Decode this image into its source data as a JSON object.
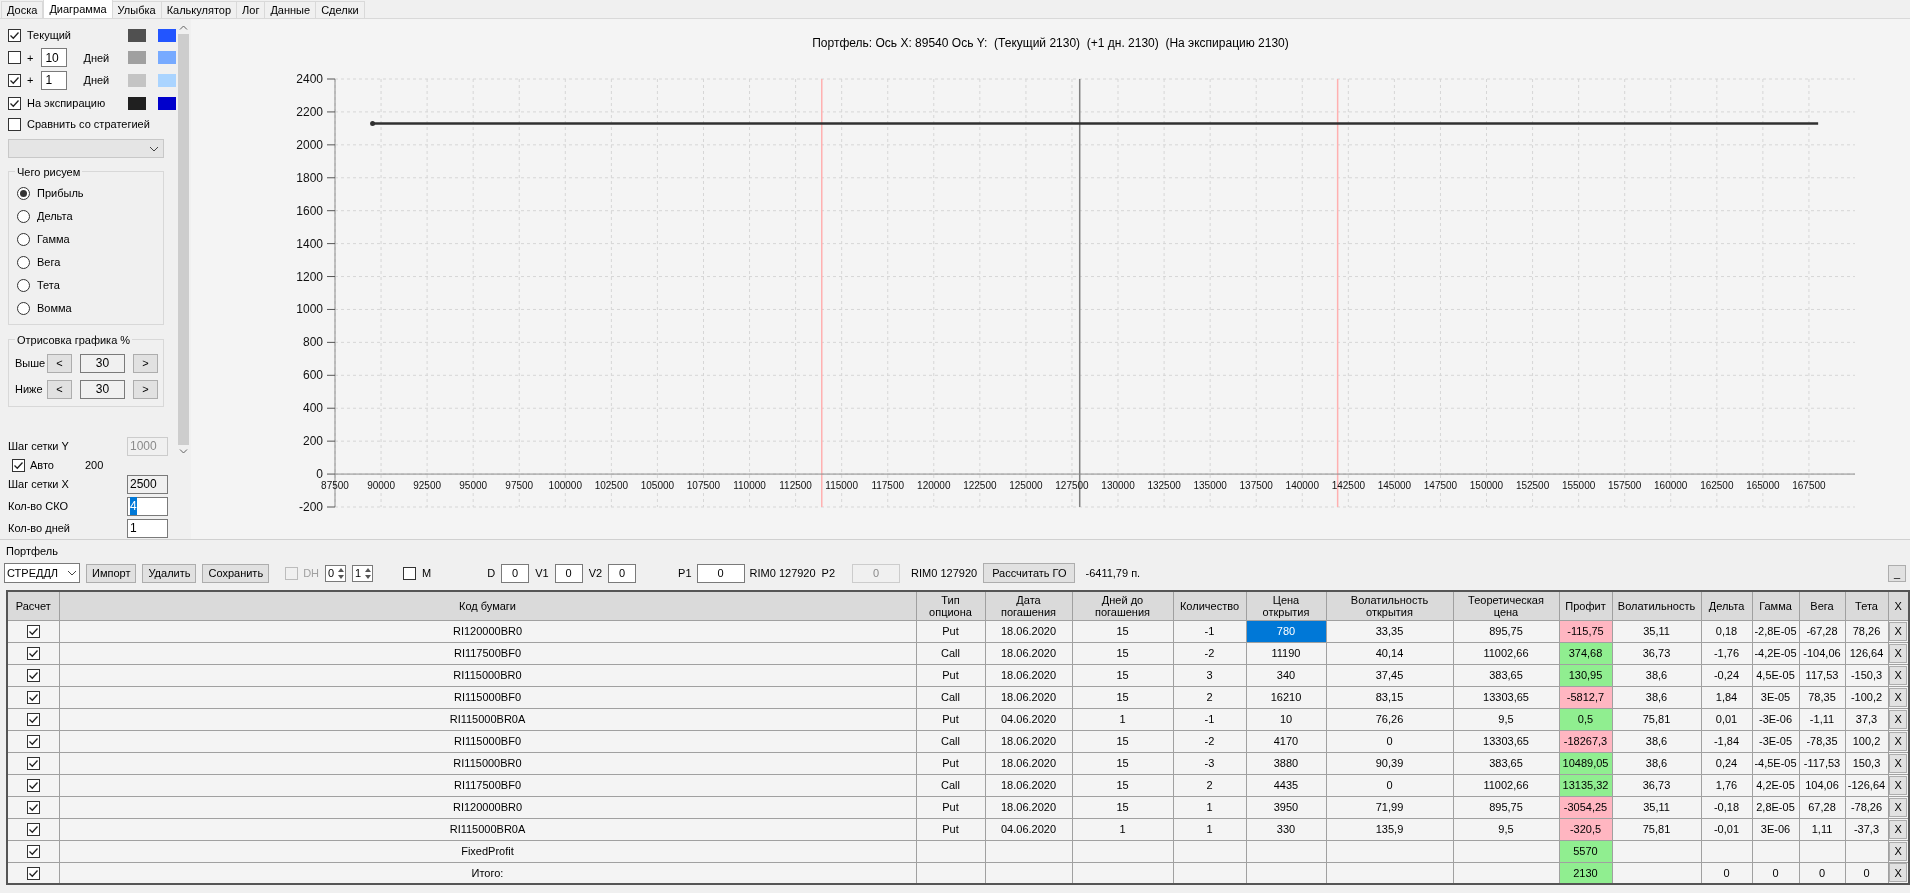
{
  "tabs": [
    {
      "label": "Доска",
      "selected": false
    },
    {
      "label": "Диаграмма",
      "selected": true
    },
    {
      "label": "Улыбка",
      "selected": false
    },
    {
      "label": "Калькулятор",
      "selected": false
    },
    {
      "label": "Лог",
      "selected": false
    },
    {
      "label": "Данные",
      "selected": false
    },
    {
      "label": "Сделки",
      "selected": false
    }
  ],
  "sidebar": {
    "curves": [
      {
        "kind": "curve",
        "label": "Текущий",
        "checked": true,
        "swatches": [
          {
            "color": "#505050"
          },
          {
            "color": "#2255ff"
          }
        ]
      },
      {
        "kind": "days",
        "prefix": "+",
        "days": "10",
        "unit": "Дней",
        "checked": false,
        "swatches": [
          {
            "color": "#a0a0a0"
          },
          {
            "color": "#77aaff"
          }
        ]
      },
      {
        "kind": "days",
        "prefix": "+",
        "days": "1",
        "unit": "Дней",
        "checked": true,
        "swatches": [
          {
            "color": "#c4c4c4"
          },
          {
            "color": "#aad4ff"
          }
        ]
      },
      {
        "kind": "curve",
        "label": "На экспирацию",
        "checked": true,
        "swatches": [
          {
            "color": "#202020"
          },
          {
            "color": "#0000cc"
          }
        ]
      }
    ],
    "compare": {
      "label": "Сравнить со стратегией",
      "checked": false
    },
    "plot_group": {
      "title": "Чего рисуем",
      "options": [
        {
          "label": "Прибыль",
          "selected": true
        },
        {
          "label": "Дельта",
          "selected": false
        },
        {
          "label": "Гамма",
          "selected": false
        },
        {
          "label": "Вега",
          "selected": false
        },
        {
          "label": "Тета",
          "selected": false
        },
        {
          "label": "Вомма",
          "selected": false
        }
      ]
    },
    "range_group": {
      "title": "Отрисовка графика %",
      "rows": [
        {
          "label": "Выше",
          "dec": "<",
          "value": "30",
          "inc": ">"
        },
        {
          "label": "Ниже",
          "dec": "<",
          "value": "30",
          "inc": ">"
        }
      ]
    },
    "settings": [
      {
        "kind": "field",
        "label": "Шаг сетки Y",
        "value": "1000",
        "disabled": true,
        "readonly": false,
        "text_selected": false
      },
      {
        "kind": "check",
        "label": "Авто",
        "checked": true,
        "value": "200"
      },
      {
        "kind": "field",
        "label": "Шаг сетки X",
        "value": "2500",
        "disabled": false,
        "readonly": true,
        "text_selected": false
      },
      {
        "kind": "field",
        "label": "Кол-во СКО",
        "value": "4",
        "disabled": false,
        "readonly": false,
        "text_selected": true
      },
      {
        "kind": "field",
        "label": "Кол-во дней",
        "value": "1",
        "disabled": false,
        "readonly": false,
        "text_selected": false
      }
    ]
  },
  "chart": {
    "chart_data": {
      "type": "line",
      "title": "Портфель: Ось X: 89540 Ось Y:  (Текущий 2130)  (+1 дн. 2130)  (На экспирацию 2130)",
      "x": [
        89540,
        168000
      ],
      "series": [
        {
          "color": "#303030",
          "values": [
            2130,
            2130
          ]
        }
      ],
      "xlim": [
        87500,
        170000
      ],
      "ylim": [
        -200,
        2400
      ],
      "xticks": [
        87500,
        90000,
        92500,
        95000,
        97500,
        100000,
        102500,
        105000,
        107500,
        110000,
        112500,
        115000,
        117500,
        120000,
        122500,
        125000,
        127500,
        130000,
        132500,
        135000,
        137500,
        140000,
        142500,
        145000,
        147500,
        150000,
        152500,
        155000,
        157500,
        160000,
        162500,
        165000,
        167500
      ],
      "yticks": [
        -200,
        0,
        200,
        400,
        600,
        800,
        1000,
        1200,
        1400,
        1600,
        1800,
        2000,
        2200,
        2400
      ],
      "grid": true,
      "ref_lines": [
        {
          "axis": "x",
          "value": 113920,
          "color": "#ffb0b0"
        },
        {
          "axis": "x",
          "value": 127920,
          "color": "#808080"
        },
        {
          "axis": "x",
          "value": 141920,
          "color": "#ffb0b0"
        }
      ]
    }
  },
  "portfolio": {
    "title": "Портфель",
    "strategy": "СТРЕДДЛ",
    "buttons": [
      "Импорт",
      "Удалить",
      "Сохранить"
    ],
    "dh": {
      "label": "DH",
      "checked": false,
      "disabled": true
    },
    "spinners": [
      "0",
      "1"
    ],
    "m": {
      "label": "M",
      "checked": false
    },
    "params": [
      {
        "label": "D",
        "value": "0"
      },
      {
        "label": "V1",
        "value": "0"
      },
      {
        "label": "V2",
        "value": "0"
      }
    ],
    "prices": [
      {
        "label": "P1",
        "value": "0",
        "note": "RIM0 127920",
        "disabled": false
      },
      {
        "label": "P2",
        "value": "0",
        "note": "RIM0 127920",
        "disabled": true
      }
    ],
    "calc_button": "Рассчитать ГО",
    "margin": "-6411,79 п.",
    "minimize": "_"
  },
  "table": {
    "columns": [
      "Расчет",
      "Код бумаги",
      "Тип\nопциона",
      "Дата\nпогашения",
      "Дней до\nпогашения",
      "Количество",
      "Цена\nоткрытия",
      "Волатильность\nоткрытия",
      "Теоретическая\nцена",
      "Профит",
      "Волатильность",
      "Дельта",
      "Гамма",
      "Вега",
      "Тета",
      "X"
    ],
    "rows": [
      {
        "checked": true,
        "selected": true,
        "color": "#ffb6c1",
        "cells": [
          null,
          "RI120000BR0",
          "Put",
          "18.06.2020",
          "15",
          "-1",
          "780",
          "33,35",
          "895,75",
          "-115,75",
          "35,11",
          "0,18",
          "-2,8E-05",
          "-67,28",
          "78,26",
          "X"
        ]
      },
      {
        "checked": true,
        "selected": false,
        "color": "#90ee90",
        "cells": [
          null,
          "RI117500BF0",
          "Call",
          "18.06.2020",
          "15",
          "-2",
          "11190",
          "40,14",
          "11002,66",
          "374,68",
          "36,73",
          "-1,76",
          "-4,2E-05",
          "-104,06",
          "126,64",
          "X"
        ]
      },
      {
        "checked": true,
        "selected": false,
        "color": "#90ee90",
        "cells": [
          null,
          "RI115000BR0",
          "Put",
          "18.06.2020",
          "15",
          "3",
          "340",
          "37,45",
          "383,65",
          "130,95",
          "38,6",
          "-0,24",
          "4,5E-05",
          "117,53",
          "-150,3",
          "X"
        ]
      },
      {
        "checked": true,
        "selected": false,
        "color": "#ffb6c1",
        "cells": [
          null,
          "RI115000BF0",
          "Call",
          "18.06.2020",
          "15",
          "2",
          "16210",
          "83,15",
          "13303,65",
          "-5812,7",
          "38,6",
          "1,84",
          "3E-05",
          "78,35",
          "-100,2",
          "X"
        ]
      },
      {
        "checked": true,
        "selected": false,
        "color": "#90ee90",
        "cells": [
          null,
          "RI115000BR0A",
          "Put",
          "04.06.2020",
          "1",
          "-1",
          "10",
          "76,26",
          "9,5",
          "0,5",
          "75,81",
          "0,01",
          "-3E-06",
          "-1,11",
          "37,3",
          "X"
        ]
      },
      {
        "checked": true,
        "selected": false,
        "color": "#ffb6c1",
        "cells": [
          null,
          "RI115000BF0",
          "Call",
          "18.06.2020",
          "15",
          "-2",
          "4170",
          "0",
          "13303,65",
          "-18267,3",
          "38,6",
          "-1,84",
          "-3E-05",
          "-78,35",
          "100,2",
          "X"
        ]
      },
      {
        "checked": true,
        "selected": false,
        "color": "#90ee90",
        "cells": [
          null,
          "RI115000BR0",
          "Put",
          "18.06.2020",
          "15",
          "-3",
          "3880",
          "90,39",
          "383,65",
          "10489,05",
          "38,6",
          "0,24",
          "-4,5E-05",
          "-117,53",
          "150,3",
          "X"
        ]
      },
      {
        "checked": true,
        "selected": false,
        "color": "#90ee90",
        "cells": [
          null,
          "RI117500BF0",
          "Call",
          "18.06.2020",
          "15",
          "2",
          "4435",
          "0",
          "11002,66",
          "13135,32",
          "36,73",
          "1,76",
          "4,2E-05",
          "104,06",
          "-126,64",
          "X"
        ]
      },
      {
        "checked": true,
        "selected": false,
        "color": "#ffb6c1",
        "cells": [
          null,
          "RI120000BR0",
          "Put",
          "18.06.2020",
          "15",
          "1",
          "3950",
          "71,99",
          "895,75",
          "-3054,25",
          "35,11",
          "-0,18",
          "2,8E-05",
          "67,28",
          "-78,26",
          "X"
        ]
      },
      {
        "checked": true,
        "selected": false,
        "color": "#ffb6c1",
        "cells": [
          null,
          "RI115000BR0A",
          "Put",
          "04.06.2020",
          "1",
          "1",
          "330",
          "135,9",
          "9,5",
          "-320,5",
          "75,81",
          "-0,01",
          "3E-06",
          "1,11",
          "-37,3",
          "X"
        ]
      },
      {
        "checked": true,
        "selected": false,
        "color": "#90ee90",
        "cells": [
          null,
          "FixedProfit",
          null,
          null,
          null,
          null,
          null,
          null,
          null,
          "5570",
          null,
          null,
          null,
          null,
          null,
          "X"
        ]
      },
      {
        "checked": true,
        "selected": false,
        "color": "#90ee90",
        "cells": [
          null,
          "Итого:",
          null,
          null,
          null,
          null,
          null,
          null,
          null,
          "2130",
          null,
          "0",
          "0",
          "0",
          "0",
          "X"
        ]
      }
    ]
  }
}
